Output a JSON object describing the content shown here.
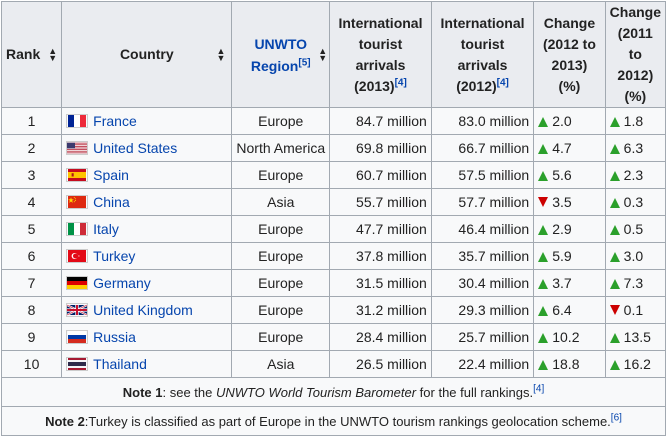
{
  "headers": {
    "rank": "Rank",
    "country": "Country",
    "region": "UNWTO Region",
    "region_ref": "[5]",
    "arrivals_2013": [
      "International",
      "tourist",
      "arrivals",
      "(2013)"
    ],
    "arrivals_2013_ref": "[4]",
    "arrivals_2012": [
      "International",
      "tourist",
      "arrivals",
      "(2012)"
    ],
    "arrivals_2012_ref": "[4]",
    "change_1213": [
      "Change",
      "(2012 to",
      "2013)",
      "(%)"
    ],
    "change_1112": [
      "Change",
      "(2011 to",
      "2012)",
      "(%)"
    ]
  },
  "rows": [
    {
      "rank": "1",
      "flag": "flag-france",
      "country": "France",
      "region": "Europe",
      "a2013": "84.7 million",
      "a2012": "83.0 million",
      "c1dir": "up",
      "c1": "2.0",
      "c2dir": "up",
      "c2": "1.8"
    },
    {
      "rank": "2",
      "flag": "flag-united-states",
      "country": "United States",
      "region": "North America",
      "a2013": "69.8 million",
      "a2012": "66.7 million",
      "c1dir": "up",
      "c1": "4.7",
      "c2dir": "up",
      "c2": "6.3"
    },
    {
      "rank": "3",
      "flag": "flag-spain",
      "country": "Spain",
      "region": "Europe",
      "a2013": "60.7 million",
      "a2012": "57.5 million",
      "c1dir": "up",
      "c1": "5.6",
      "c2dir": "up",
      "c2": "2.3"
    },
    {
      "rank": "4",
      "flag": "flag-china",
      "country": "China",
      "region": "Asia",
      "a2013": "55.7 million",
      "a2012": "57.7 million",
      "c1dir": "down",
      "c1": "3.5",
      "c2dir": "up",
      "c2": "0.3"
    },
    {
      "rank": "5",
      "flag": "flag-italy",
      "country": "Italy",
      "region": "Europe",
      "a2013": "47.7 million",
      "a2012": "46.4 million",
      "c1dir": "up",
      "c1": "2.9",
      "c2dir": "up",
      "c2": "0.5"
    },
    {
      "rank": "6",
      "flag": "flag-turkey",
      "country": "Turkey",
      "region": "Europe",
      "a2013": "37.8 million",
      "a2012": "35.7 million",
      "c1dir": "up",
      "c1": "5.9",
      "c2dir": "up",
      "c2": "3.0"
    },
    {
      "rank": "7",
      "flag": "flag-germany",
      "country": "Germany",
      "region": "Europe",
      "a2013": "31.5 million",
      "a2012": "30.4 million",
      "c1dir": "up",
      "c1": "3.7",
      "c2dir": "up",
      "c2": "7.3"
    },
    {
      "rank": "8",
      "flag": "flag-united-kingdom",
      "country": "United Kingdom",
      "region": "Europe",
      "a2013": "31.2 million",
      "a2012": "29.3 million",
      "c1dir": "up",
      "c1": "6.4",
      "c2dir": "down",
      "c2": "0.1"
    },
    {
      "rank": "9",
      "flag": "flag-russia",
      "country": "Russia",
      "region": "Europe",
      "a2013": "28.4 million",
      "a2012": "25.7 million",
      "c1dir": "up",
      "c1": "10.2",
      "c2dir": "up",
      "c2": "13.5"
    },
    {
      "rank": "10",
      "flag": "flag-thailand",
      "country": "Thailand",
      "region": "Asia",
      "a2013": "26.5 million",
      "a2012": "22.4 million",
      "c1dir": "up",
      "c1": "18.8",
      "c2dir": "up",
      "c2": "16.2"
    }
  ],
  "notes": {
    "note1_label": "Note 1",
    "note1_pre": ": see the ",
    "note1_italic": "UNWTO World Tourism Barometer",
    "note1_post": " for the full rankings.",
    "note1_ref": "[4]",
    "note2_label": "Note 2",
    "note2_text": ":Turkey is classified as part of Europe in the UNWTO tourism rankings geolocation scheme.",
    "note2_ref": "[6]"
  },
  "colors": {
    "link": "#0645ad",
    "up": "#2ba02b",
    "down": "#cc0000",
    "header_bg": "#eaecf0"
  }
}
